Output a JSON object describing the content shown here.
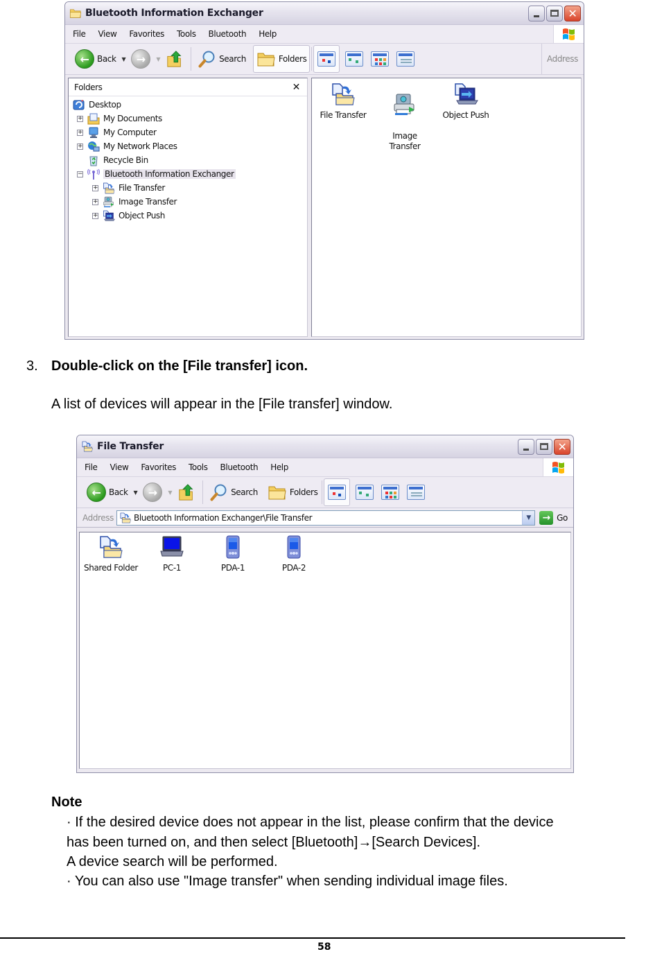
{
  "window1": {
    "title": "Bluetooth Information Exchanger",
    "menu": [
      "File",
      "View",
      "Favorites",
      "Tools",
      "Bluetooth",
      "Help"
    ],
    "toolbar": {
      "back_label": "Back",
      "search_label": "Search",
      "folders_label": "Folders",
      "address_label": "Address"
    },
    "folders_pane": {
      "title": "Folders",
      "close_glyph": "✕",
      "tree": [
        {
          "label": "Desktop",
          "icon": "desktop-icon",
          "level": 0,
          "expander": "none"
        },
        {
          "label": "My Documents",
          "icon": "my-documents-icon",
          "level": 1,
          "expander": "+"
        },
        {
          "label": "My Computer",
          "icon": "my-computer-icon",
          "level": 1,
          "expander": "+"
        },
        {
          "label": "My Network Places",
          "icon": "network-places-icon",
          "level": 1,
          "expander": "+"
        },
        {
          "label": "Recycle Bin",
          "icon": "recycle-bin-icon",
          "level": 1,
          "expander": "none"
        },
        {
          "label": "Bluetooth Information Exchanger",
          "icon": "bluetooth-icon",
          "level": 1,
          "expander": "-",
          "selected": true
        },
        {
          "label": "File Transfer",
          "icon": "file-transfer-icon",
          "level": 2,
          "expander": "+"
        },
        {
          "label": "Image Transfer",
          "icon": "image-transfer-icon",
          "level": 2,
          "expander": "+"
        },
        {
          "label": "Object Push",
          "icon": "object-push-icon",
          "level": 2,
          "expander": "+"
        }
      ]
    },
    "items": [
      {
        "label": "File Transfer",
        "icon": "file-transfer-icon"
      },
      {
        "label": "Image\nTransfer",
        "icon": "image-transfer-icon"
      },
      {
        "label": "Object Push",
        "icon": "object-push-icon"
      }
    ]
  },
  "step": {
    "number": "3.",
    "instruction": "Double-click on the [File transfer] icon.",
    "description": "A list of devices will appear in the [File transfer] window."
  },
  "window2": {
    "title": "File Transfer",
    "menu": [
      "File",
      "View",
      "Favorites",
      "Tools",
      "Bluetooth",
      "Help"
    ],
    "toolbar": {
      "back_label": "Back",
      "search_label": "Search",
      "folders_label": "Folders"
    },
    "address": {
      "label": "Address",
      "value": "Bluetooth Information Exchanger\\File Transfer",
      "go_label": "Go"
    },
    "items": [
      {
        "label": "Shared Folder",
        "icon": "shared-folder-icon"
      },
      {
        "label": "PC-1",
        "icon": "laptop-icon"
      },
      {
        "label": "PDA-1",
        "icon": "pda-icon"
      },
      {
        "label": "PDA-2",
        "icon": "pda-icon"
      }
    ]
  },
  "note": {
    "title": "Note",
    "lines": [
      "· If the desired device does not appear in the list, please confirm that the device",
      "has been turned on, and then select [Bluetooth]→[Search Devices].",
      "A device search will be performed.",
      "· You can also use \"Image transfer\" when sending individual image files."
    ]
  },
  "footer": {
    "page_number": "58"
  }
}
